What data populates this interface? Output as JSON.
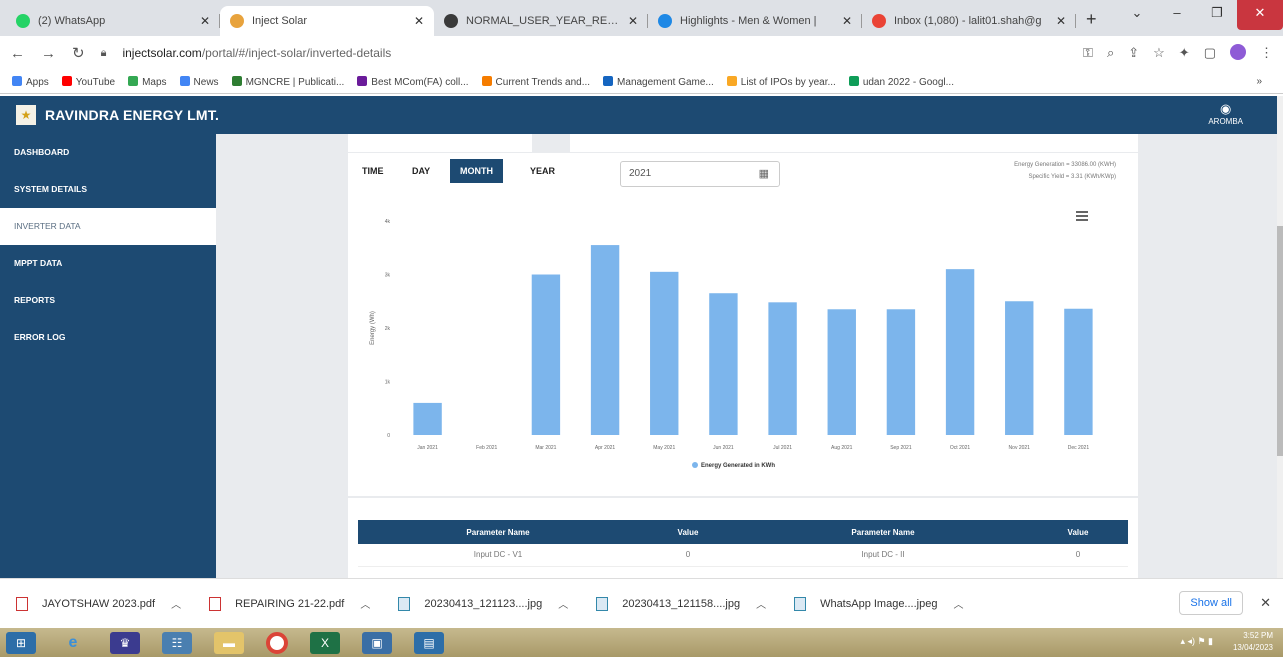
{
  "browser": {
    "tabs": [
      {
        "title": "(2) WhatsApp",
        "color": "#25d366"
      },
      {
        "title": "Inject Solar",
        "color": "#e8a33d"
      },
      {
        "title": "NORMAL_USER_YEAR_REPORT",
        "color": "#3a3a3a"
      },
      {
        "title": "Highlights - Men & Women |",
        "color": "#1e88e5"
      },
      {
        "title": "Inbox (1,080) - lalit01.shah@g",
        "color": "#ea4335"
      }
    ],
    "new_tab": "+",
    "url_domain": "injectsolar.com",
    "url_path": "/portal/#/inject-solar/inverted-details",
    "bookmarks": [
      {
        "label": "Apps",
        "color": "#4285f4"
      },
      {
        "label": "YouTube",
        "color": "#ff0000"
      },
      {
        "label": "Maps",
        "color": "#34a853"
      },
      {
        "label": "News",
        "color": "#4285f4"
      },
      {
        "label": "MGNCRE | Publicati...",
        "color": "#2e7d32"
      },
      {
        "label": "Best MCom(FA) coll...",
        "color": "#6a1b9a"
      },
      {
        "label": "Current Trends and...",
        "color": "#f57c00"
      },
      {
        "label": "Management Game...",
        "color": "#1565c0"
      },
      {
        "label": "List of IPOs by year...",
        "color": "#f9a825"
      },
      {
        "label": "udan 2022 - Googl...",
        "color": "#0f9d58"
      }
    ],
    "bookmarks_more": "»"
  },
  "app": {
    "brand": "RAVINDRA ENERGY LMT.",
    "user_label": "AROMBA",
    "colors": {
      "primary": "#1d4a72",
      "bar": "#7cb5ec"
    }
  },
  "sidebar": {
    "items": [
      {
        "label": "DASHBOARD"
      },
      {
        "label": "SYSTEM DETAILS"
      },
      {
        "label": "INVERTER DATA"
      },
      {
        "label": "MPPT DATA"
      },
      {
        "label": "REPORTS"
      },
      {
        "label": "ERROR LOG"
      }
    ]
  },
  "controls": {
    "tabs": [
      "TIME",
      "DAY",
      "MONTH",
      "YEAR"
    ],
    "active_tab": "MONTH",
    "year": "2021",
    "energy_generation": "Energy Generation = 33086.00 (KWH)",
    "specific_yield": "Specific Yield = 3.31 (KWh/KWp)"
  },
  "chart_data": {
    "type": "bar",
    "categories": [
      "Jan 2021",
      "Feb 2021",
      "Mar 2021",
      "Apr 2021",
      "May 2021",
      "Jun 2021",
      "Jul 2021",
      "Aug 2021",
      "Sep 2021",
      "Oct 2021",
      "Nov 2021",
      "Dec 2021"
    ],
    "series": [
      {
        "name": "Energy Generated in KWh",
        "values": [
          600,
          0,
          3000,
          3550,
          3050,
          2650,
          2480,
          2350,
          2350,
          3100,
          2500,
          2360
        ]
      }
    ],
    "ylabel": "Energy (Wh)",
    "yticks": [
      "0",
      "1k",
      "2k",
      "3k",
      "4k"
    ],
    "ylim": [
      0,
      4000
    ],
    "legend": "bottom-center"
  },
  "table": {
    "headers": [
      "Parameter Name",
      "Value",
      "Parameter Name",
      "Value"
    ],
    "rows": [
      [
        "Input DC - V1",
        "0",
        "Input DC - II",
        "0"
      ]
    ]
  },
  "downloads": {
    "items": [
      {
        "name": "JAYOTSHAW 2023.pdf",
        "kind": "pdf"
      },
      {
        "name": "REPAIRING 21-22.pdf",
        "kind": "pdf"
      },
      {
        "name": "20230413_121123....jpg",
        "kind": "img"
      },
      {
        "name": "20230413_121158....jpg",
        "kind": "img"
      },
      {
        "name": "WhatsApp Image....jpeg",
        "kind": "img"
      }
    ],
    "show_all": "Show all"
  },
  "taskbar": {
    "time": "3:52 PM",
    "date": "13/04/2023"
  }
}
